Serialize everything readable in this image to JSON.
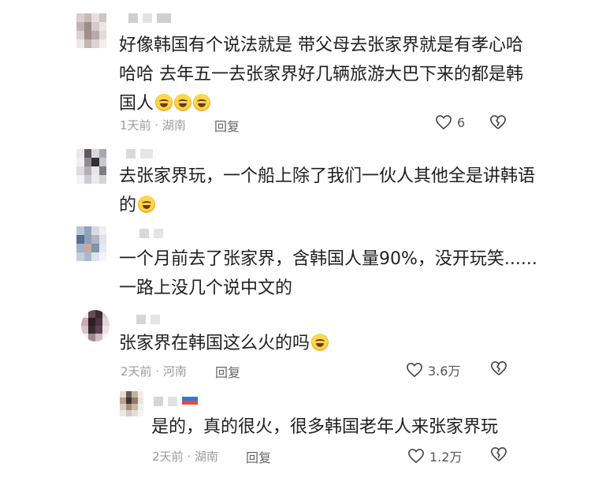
{
  "comments": [
    {
      "lines": [
        "好像韩国有个说法就是 带父母去张家界就是有孝心哈",
        "哈哈 去年五一去张家界好几辆旅游大巴下来的都是韩",
        "国人"
      ],
      "meta": "1天前 · 湖南",
      "reply_label": "回复",
      "likes": "6"
    },
    {
      "lines": [
        "去张家界玩，一个船上除了我们一伙人其他全是讲韩语",
        "的"
      ]
    },
    {
      "lines": [
        "一个月前去了张家界，含韩国人量90%，没开玩笑......",
        "一路上没几个说中文的"
      ]
    },
    {
      "lines": [
        "张家界在韩国这么火的吗"
      ],
      "meta": "2天前 · 河南",
      "reply_label": "回复",
      "likes": "3.6万"
    }
  ],
  "reply": {
    "lines": [
      "是的，真的很火，很多韩国老年人来张家界玩"
    ],
    "meta": "2天前 · 湖南",
    "reply_label": "回复",
    "likes": "1.2万"
  },
  "icons": [
    "avatar",
    "laugh-cry-emoji",
    "heart-outline-icon",
    "broken-heart-icon"
  ]
}
